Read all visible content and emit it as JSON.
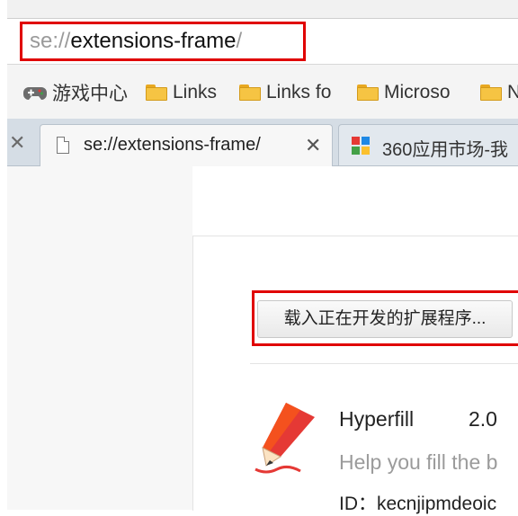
{
  "address_bar": {
    "scheme": "se:",
    "slashes": "//",
    "host": "extensions-frame",
    "trail": "/"
  },
  "bookmarks": [
    {
      "label": "游戏中心",
      "icon": "gamepad-icon"
    },
    {
      "label": "Links",
      "icon": "folder-icon"
    },
    {
      "label": "Links fo",
      "icon": "folder-icon"
    },
    {
      "label": "Microso",
      "icon": "folder-icon"
    },
    {
      "label": "N",
      "icon": "folder-icon"
    }
  ],
  "tabs": [
    {
      "title": "se://extensions-frame/",
      "icon": "page-icon",
      "active": true
    },
    {
      "title": "360应用市场-我",
      "icon": "app-market-icon",
      "active": false
    }
  ],
  "tab_close_glyph": "✕",
  "extensions_page": {
    "load_button": "载入正在开发的扩展程序...",
    "extension": {
      "name": "Hyperfill",
      "version": "2.0",
      "description": "Help you fill the b",
      "id_label": "ID：kecnjipmdeoic"
    }
  },
  "colors": {
    "highlight": "#e00000",
    "folder": "#f6c443"
  }
}
